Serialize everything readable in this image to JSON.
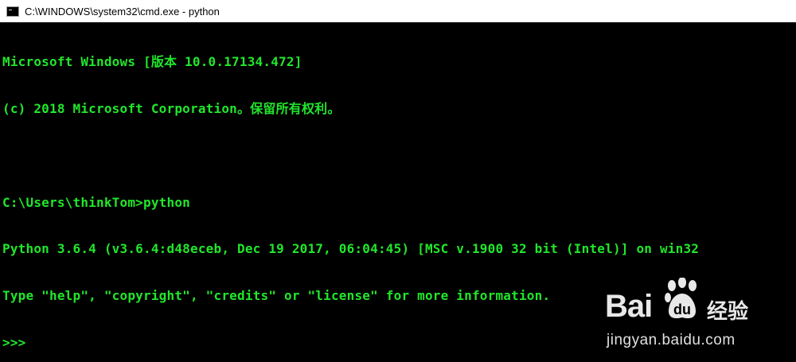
{
  "window": {
    "title": "C:\\WINDOWS\\system32\\cmd.exe - python",
    "icon": "console-app-icon"
  },
  "console": {
    "foreground_color": "#21e62b",
    "background_color": "#000000",
    "lines": [
      "Microsoft Windows [版本 10.0.17134.472]",
      "(c) 2018 Microsoft Corporation。保留所有权利。",
      "",
      "C:\\Users\\thinkTom>python",
      "Python 3.6.4 (v3.6.4:d48eceb, Dec 19 2017, 06:04:45) [MSC v.1900 32 bit (Intel)] on win32",
      "Type \"help\", \"copyright\", \"credits\" or \"license\" for more information."
    ],
    "prompt": ">>>"
  },
  "watermark": {
    "brand": "Bai",
    "brand_suffix": "经验",
    "url": "jingyan.baidu.com"
  }
}
